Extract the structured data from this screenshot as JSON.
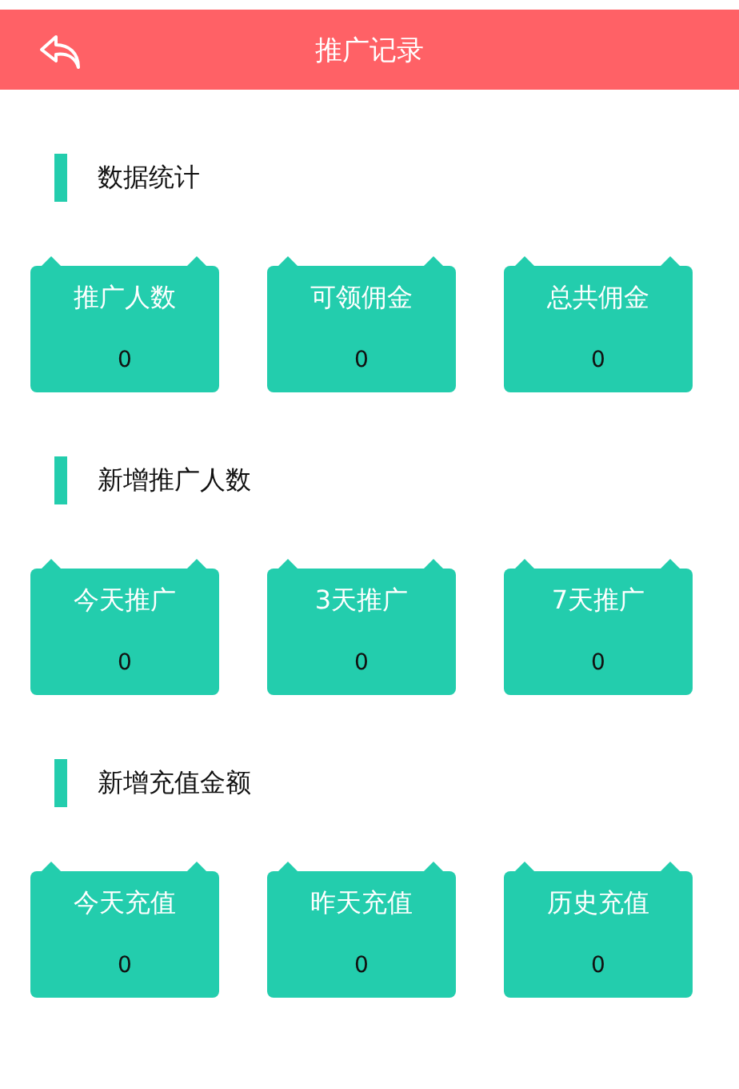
{
  "header": {
    "title": "推广记录"
  },
  "sections": [
    {
      "title": "数据统计",
      "cards": [
        {
          "label": "推广人数",
          "value": "0"
        },
        {
          "label": "可领佣金",
          "value": "0"
        },
        {
          "label": "总共佣金",
          "value": "0"
        }
      ]
    },
    {
      "title": "新增推广人数",
      "cards": [
        {
          "label": "今天推广",
          "value": "0"
        },
        {
          "label": "3天推广",
          "value": "0"
        },
        {
          "label": "7天推广",
          "value": "0"
        }
      ]
    },
    {
      "title": "新增充值金额",
      "cards": [
        {
          "label": "今天充值",
          "value": "0"
        },
        {
          "label": "昨天充值",
          "value": "0"
        },
        {
          "label": "历史充值",
          "value": "0"
        }
      ]
    }
  ]
}
